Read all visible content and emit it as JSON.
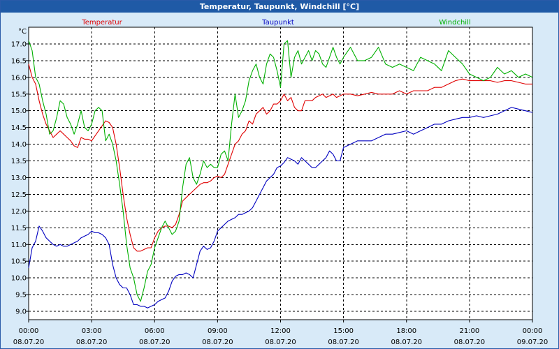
{
  "window": {
    "title": "Temperatur, Taupunkt, Windchill [°C]"
  },
  "chart_data": {
    "type": "line",
    "title": "Temperatur, Taupunkt, Windchill [°C]",
    "ylabel": "°C",
    "ylim": [
      8.75,
      17.5
    ],
    "grid": true,
    "legend": "top",
    "x_ticks": [
      {
        "time": "00:00",
        "date": "08.07.20"
      },
      {
        "time": "03:00",
        "date": "08.07.20"
      },
      {
        "time": "06:00",
        "date": "08.07.20"
      },
      {
        "time": "09:00",
        "date": "08.07.20"
      },
      {
        "time": "12:00",
        "date": "08.07.20"
      },
      {
        "time": "15:00",
        "date": "08.07.20"
      },
      {
        "time": "18:00",
        "date": "08.07.20"
      },
      {
        "time": "21:00",
        "date": "08.07.20"
      },
      {
        "time": "00:00",
        "date": "09.07.20"
      }
    ],
    "y_ticks": [
      "9.0",
      "9.5",
      "10.0",
      "10.5",
      "11.0",
      "11.5",
      "12.0",
      "12.5",
      "13.0",
      "13.5",
      "14.0",
      "14.5",
      "15.0",
      "15.5",
      "16.0",
      "16.5",
      "17.0"
    ],
    "series": [
      {
        "name": "Temperatur",
        "color": "#e00000",
        "x": [
          "00:00",
          "00:10",
          "00:20",
          "00:30",
          "00:40",
          "00:50",
          "01:00",
          "01:10",
          "01:20",
          "01:30",
          "01:40",
          "01:50",
          "02:00",
          "02:10",
          "02:20",
          "02:30",
          "02:40",
          "02:50",
          "03:00",
          "03:10",
          "03:20",
          "03:30",
          "03:40",
          "03:50",
          "04:00",
          "04:10",
          "04:20",
          "04:30",
          "04:40",
          "04:50",
          "05:00",
          "05:10",
          "05:20",
          "05:30",
          "05:40",
          "05:50",
          "06:00",
          "06:10",
          "06:20",
          "06:30",
          "06:40",
          "06:50",
          "07:00",
          "07:10",
          "07:20",
          "07:30",
          "07:40",
          "07:50",
          "08:00",
          "08:10",
          "08:20",
          "08:30",
          "08:40",
          "08:50",
          "09:00",
          "09:10",
          "09:20",
          "09:30",
          "09:40",
          "09:50",
          "10:00",
          "10:10",
          "10:20",
          "10:30",
          "10:40",
          "10:50",
          "11:00",
          "11:10",
          "11:20",
          "11:30",
          "11:40",
          "11:50",
          "12:00",
          "12:10",
          "12:20",
          "12:30",
          "12:40",
          "12:50",
          "13:00",
          "13:10",
          "13:20",
          "13:30",
          "13:40",
          "13:50",
          "14:00",
          "14:10",
          "14:20",
          "14:30",
          "14:40",
          "14:50",
          "15:00",
          "15:20",
          "15:40",
          "16:00",
          "16:20",
          "16:40",
          "17:00",
          "17:20",
          "17:40",
          "18:00",
          "18:20",
          "18:40",
          "19:00",
          "19:20",
          "19:40",
          "20:00",
          "20:20",
          "20:40",
          "21:00",
          "21:20",
          "21:40",
          "22:00",
          "22:20",
          "22:40",
          "23:00",
          "23:20",
          "23:40",
          "00:00"
        ],
        "values": [
          16.4,
          16.0,
          15.8,
          15.3,
          14.9,
          14.6,
          14.4,
          14.2,
          14.3,
          14.4,
          14.3,
          14.2,
          14.1,
          13.95,
          13.9,
          14.2,
          14.15,
          14.15,
          14.1,
          14.25,
          14.4,
          14.55,
          14.7,
          14.65,
          14.5,
          14.0,
          13.3,
          12.5,
          11.8,
          11.3,
          10.9,
          10.8,
          10.8,
          10.85,
          10.9,
          10.9,
          11.2,
          11.4,
          11.5,
          11.55,
          11.55,
          11.5,
          11.6,
          11.9,
          12.3,
          12.4,
          12.5,
          12.6,
          12.7,
          12.8,
          12.85,
          12.85,
          12.9,
          13.0,
          13.05,
          13.0,
          13.1,
          13.4,
          13.7,
          14.0,
          14.1,
          14.3,
          14.4,
          14.7,
          14.6,
          14.9,
          15.0,
          15.1,
          14.9,
          15.0,
          15.2,
          15.2,
          15.3,
          15.5,
          15.3,
          15.4,
          15.1,
          15.0,
          15.0,
          15.3,
          15.3,
          15.3,
          15.4,
          15.45,
          15.5,
          15.4,
          15.45,
          15.5,
          15.4,
          15.45,
          15.5,
          15.5,
          15.45,
          15.5,
          15.55,
          15.5,
          15.5,
          15.5,
          15.6,
          15.5,
          15.6,
          15.6,
          15.6,
          15.7,
          15.7,
          15.8,
          15.9,
          15.95,
          15.9,
          15.9,
          15.9,
          15.9,
          15.85,
          15.9,
          15.9,
          15.85,
          15.8,
          15.8
        ]
      },
      {
        "name": "Taupunkt",
        "color": "#0000c0",
        "x": [
          "00:00",
          "00:10",
          "00:20",
          "00:30",
          "00:40",
          "00:50",
          "01:00",
          "01:10",
          "01:20",
          "01:30",
          "01:40",
          "01:50",
          "02:00",
          "02:10",
          "02:20",
          "02:30",
          "02:40",
          "02:50",
          "03:00",
          "03:10",
          "03:20",
          "03:30",
          "03:40",
          "03:50",
          "04:00",
          "04:10",
          "04:20",
          "04:30",
          "04:40",
          "04:50",
          "05:00",
          "05:10",
          "05:20",
          "05:30",
          "05:40",
          "05:50",
          "06:00",
          "06:10",
          "06:20",
          "06:30",
          "06:40",
          "06:50",
          "07:00",
          "07:10",
          "07:20",
          "07:30",
          "07:40",
          "07:50",
          "08:00",
          "08:10",
          "08:20",
          "08:30",
          "08:40",
          "08:50",
          "09:00",
          "09:10",
          "09:20",
          "09:30",
          "09:40",
          "09:50",
          "10:00",
          "10:10",
          "10:20",
          "10:30",
          "10:40",
          "10:50",
          "11:00",
          "11:10",
          "11:20",
          "11:30",
          "11:40",
          "11:50",
          "12:00",
          "12:10",
          "12:20",
          "12:30",
          "12:40",
          "12:50",
          "13:00",
          "13:10",
          "13:20",
          "13:30",
          "13:40",
          "13:50",
          "14:00",
          "14:10",
          "14:20",
          "14:30",
          "14:40",
          "14:50",
          "15:00",
          "15:20",
          "15:40",
          "16:00",
          "16:20",
          "16:40",
          "17:00",
          "17:20",
          "17:40",
          "18:00",
          "18:20",
          "18:40",
          "19:00",
          "19:20",
          "19:40",
          "20:00",
          "20:20",
          "20:40",
          "21:00",
          "21:20",
          "21:40",
          "22:00",
          "22:20",
          "22:40",
          "23:00",
          "23:20",
          "23:40",
          "00:00"
        ],
        "values": [
          10.3,
          10.9,
          11.1,
          11.55,
          11.4,
          11.2,
          11.1,
          11.0,
          10.95,
          11.0,
          10.95,
          10.95,
          11.0,
          11.05,
          11.1,
          11.2,
          11.25,
          11.3,
          11.4,
          11.35,
          11.35,
          11.3,
          11.2,
          11.0,
          10.4,
          10.0,
          9.8,
          9.7,
          9.7,
          9.5,
          9.2,
          9.2,
          9.15,
          9.15,
          9.1,
          9.15,
          9.2,
          9.3,
          9.35,
          9.4,
          9.6,
          9.9,
          10.05,
          10.1,
          10.1,
          10.15,
          10.1,
          10.0,
          10.4,
          10.8,
          10.95,
          10.85,
          10.9,
          11.1,
          11.4,
          11.5,
          11.6,
          11.7,
          11.75,
          11.8,
          11.9,
          11.9,
          11.95,
          12.0,
          12.1,
          12.3,
          12.5,
          12.7,
          12.9,
          13.0,
          13.1,
          13.3,
          13.35,
          13.45,
          13.6,
          13.55,
          13.5,
          13.4,
          13.6,
          13.5,
          13.4,
          13.3,
          13.3,
          13.4,
          13.5,
          13.6,
          13.8,
          13.7,
          13.5,
          13.5,
          13.9,
          14.0,
          14.1,
          14.1,
          14.1,
          14.2,
          14.3,
          14.3,
          14.35,
          14.4,
          14.3,
          14.4,
          14.5,
          14.6,
          14.6,
          14.7,
          14.75,
          14.8,
          14.8,
          14.85,
          14.8,
          14.85,
          14.9,
          15.0,
          15.1,
          15.05,
          15.0,
          14.95
        ]
      },
      {
        "name": "Windchill",
        "color": "#00b000",
        "x": [
          "00:00",
          "00:10",
          "00:20",
          "00:30",
          "00:40",
          "00:50",
          "01:00",
          "01:10",
          "01:20",
          "01:30",
          "01:40",
          "01:50",
          "02:00",
          "02:10",
          "02:20",
          "02:30",
          "02:40",
          "02:50",
          "03:00",
          "03:10",
          "03:20",
          "03:30",
          "03:40",
          "03:50",
          "04:00",
          "04:10",
          "04:20",
          "04:30",
          "04:40",
          "04:50",
          "05:00",
          "05:10",
          "05:20",
          "05:30",
          "05:40",
          "05:50",
          "06:00",
          "06:10",
          "06:20",
          "06:30",
          "06:40",
          "06:50",
          "07:00",
          "07:10",
          "07:20",
          "07:30",
          "07:40",
          "07:50",
          "08:00",
          "08:10",
          "08:20",
          "08:30",
          "08:40",
          "08:50",
          "09:00",
          "09:10",
          "09:20",
          "09:30",
          "09:40",
          "09:50",
          "10:00",
          "10:10",
          "10:20",
          "10:30",
          "10:40",
          "10:50",
          "11:00",
          "11:10",
          "11:20",
          "11:30",
          "11:40",
          "11:50",
          "12:00",
          "12:10",
          "12:20",
          "12:30",
          "12:40",
          "12:50",
          "13:00",
          "13:10",
          "13:20",
          "13:30",
          "13:40",
          "13:50",
          "14:00",
          "14:10",
          "14:20",
          "14:30",
          "14:40",
          "14:50",
          "15:00",
          "15:20",
          "15:40",
          "16:00",
          "16:20",
          "16:40",
          "17:00",
          "17:20",
          "17:40",
          "18:00",
          "18:20",
          "18:40",
          "19:00",
          "19:20",
          "19:40",
          "20:00",
          "20:20",
          "20:40",
          "21:00",
          "21:20",
          "21:40",
          "22:00",
          "22:20",
          "22:40",
          "23:00",
          "23:20",
          "23:40",
          "00:00"
        ],
        "values": [
          17.1,
          16.8,
          16.0,
          15.8,
          15.3,
          14.9,
          14.3,
          14.4,
          14.8,
          15.3,
          15.2,
          14.8,
          14.6,
          14.3,
          14.6,
          15.0,
          14.5,
          14.4,
          14.6,
          15.0,
          15.1,
          15.0,
          14.1,
          14.3,
          14.0,
          13.5,
          12.8,
          12.0,
          11.0,
          10.3,
          10.0,
          9.5,
          9.3,
          9.7,
          10.2,
          10.4,
          10.9,
          11.2,
          11.5,
          11.7,
          11.5,
          11.3,
          11.4,
          11.7,
          12.7,
          13.4,
          13.6,
          13.0,
          12.8,
          13.1,
          13.5,
          13.3,
          13.4,
          13.3,
          13.3,
          13.7,
          13.8,
          13.5,
          14.6,
          15.5,
          14.8,
          15.0,
          15.3,
          15.9,
          16.2,
          16.4,
          16.0,
          15.8,
          16.4,
          16.7,
          16.6,
          16.2,
          15.7,
          17.0,
          17.1,
          16.0,
          16.6,
          16.8,
          16.4,
          16.6,
          16.8,
          16.5,
          16.8,
          16.7,
          16.4,
          16.3,
          16.6,
          16.9,
          16.6,
          16.4,
          16.6,
          16.9,
          16.5,
          16.5,
          16.6,
          16.9,
          16.4,
          16.3,
          16.4,
          16.3,
          16.2,
          16.6,
          16.5,
          16.4,
          16.2,
          16.8,
          16.6,
          16.4,
          16.1,
          16.0,
          15.9,
          16.0,
          16.3,
          16.1,
          16.2,
          16.0,
          16.1,
          16.0
        ]
      }
    ]
  }
}
